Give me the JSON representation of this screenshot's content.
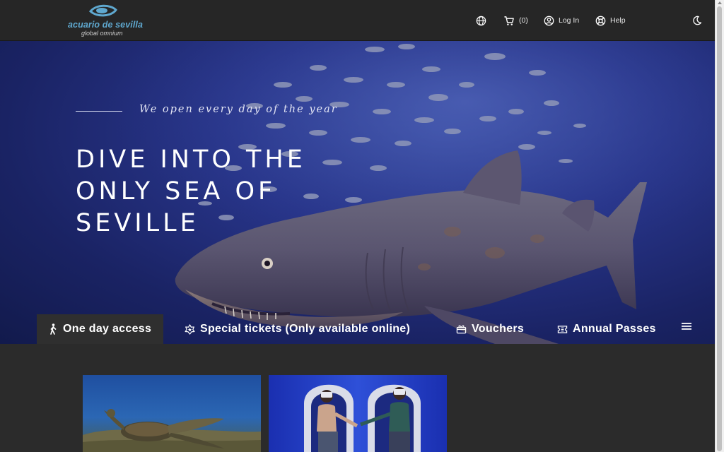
{
  "header": {
    "logo": {
      "name": "acuario de sevilla",
      "subtitle": "global omnium"
    },
    "cart_count": "(0)",
    "login_label": "Log In",
    "help_label": "Help",
    "icons": [
      "globe-icon",
      "cart-icon",
      "user-icon",
      "help-icon",
      "moon-icon"
    ]
  },
  "hero": {
    "tagline": "We open every day of the year",
    "title": "DIVE INTO THE ONLY SEA OF SEVILLE"
  },
  "tabs": [
    {
      "label": "One day access",
      "icon": "walking-person-icon",
      "active": true
    },
    {
      "label": "Special tickets (Only available online)",
      "icon": "star-badge-icon",
      "active": false
    },
    {
      "label": "Vouchers",
      "icon": "gift-icon",
      "active": false
    },
    {
      "label": "Annual Passes",
      "icon": "ticket-icon",
      "active": false
    }
  ],
  "cards": [
    {
      "image": "sea-turtle-photo"
    },
    {
      "image": "vr-experience-photo"
    }
  ],
  "colors": {
    "header_bg": "#262626",
    "page_bg": "#2b2b2b",
    "hero_blue": "#28358a",
    "logo_blue": "#5fa8cf"
  }
}
